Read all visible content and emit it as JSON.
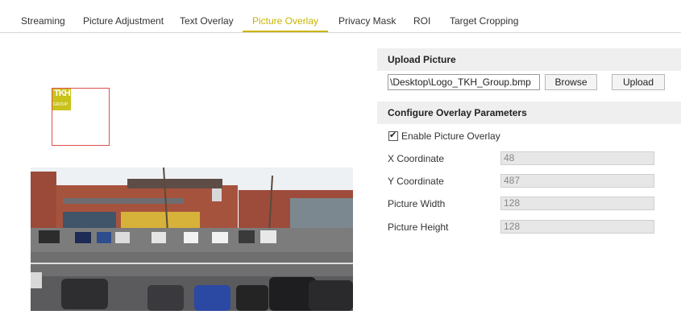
{
  "tabs": [
    {
      "label": "Streaming"
    },
    {
      "label": "Picture Adjustment"
    },
    {
      "label": "Text Overlay"
    },
    {
      "label": "Picture Overlay",
      "active": true
    },
    {
      "label": "Privacy Mask"
    },
    {
      "label": "ROI"
    },
    {
      "label": "Target Cropping"
    }
  ],
  "preview": {
    "logo_text": "TKH",
    "logo_subtext": "GROUP"
  },
  "upload": {
    "header": "Upload Picture",
    "file_path": "\\Desktop\\Logo_TKH_Group.bmp",
    "browse_label": "Browse",
    "upload_label": "Upload"
  },
  "overlay_params": {
    "header": "Configure Overlay Parameters",
    "enable_label": "Enable Picture Overlay",
    "enabled": true,
    "fields": [
      {
        "label": "X Coordinate",
        "value": "48"
      },
      {
        "label": "Y Coordinate",
        "value": "487"
      },
      {
        "label": "Picture Width",
        "value": "128"
      },
      {
        "label": "Picture Height",
        "value": "128"
      }
    ]
  },
  "colors": {
    "active_tab": "#c8b400",
    "logo_bg": "#c9c21a",
    "overlay_box_border": "#e05050"
  }
}
